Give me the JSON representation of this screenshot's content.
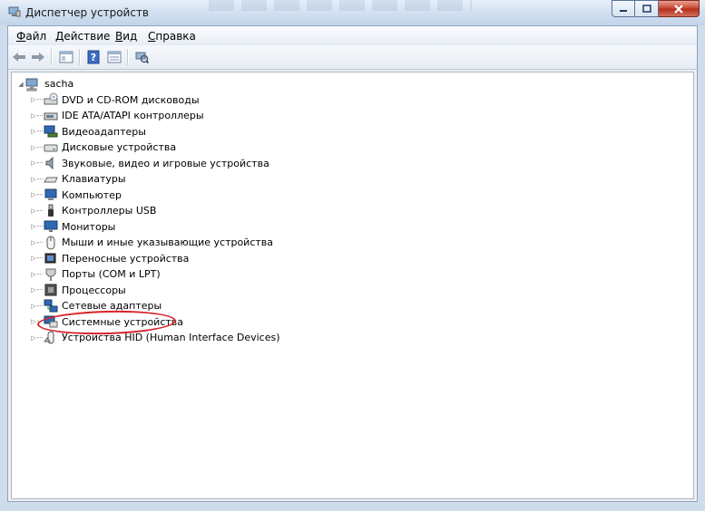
{
  "window": {
    "title": "Диспетчер устройств"
  },
  "menu": [
    {
      "first": "Ф",
      "rest": "айл"
    },
    {
      "first": "Д",
      "rest": "ействие"
    },
    {
      "first": "В",
      "rest": "ид"
    },
    {
      "first": "С",
      "rest": "правка"
    }
  ],
  "toolbar": {
    "icons": [
      "back-arrow-icon",
      "forward-arrow-icon",
      "properties-icon",
      "help-icon",
      "view-icon",
      "scan-hardware-icon"
    ]
  },
  "tree": {
    "root": "sacha",
    "items": [
      {
        "label": "DVD и CD-ROM дисководы",
        "icon": "dvd-drive-icon"
      },
      {
        "label": "IDE ATA/ATAPI контроллеры",
        "icon": "ide-controller-icon"
      },
      {
        "label": "Видеоадаптеры",
        "icon": "display-adapter-icon"
      },
      {
        "label": "Дисковые устройства",
        "icon": "disk-drive-icon"
      },
      {
        "label": "Звуковые, видео и игровые устройства",
        "icon": "speaker-icon"
      },
      {
        "label": "Клавиатуры",
        "icon": "keyboard-icon"
      },
      {
        "label": "Компьютер",
        "icon": "computer-icon"
      },
      {
        "label": "Контроллеры USB",
        "icon": "usb-icon"
      },
      {
        "label": "Мониторы",
        "icon": "monitor-icon"
      },
      {
        "label": "Мыши и иные указывающие устройства",
        "icon": "mouse-icon"
      },
      {
        "label": "Переносные устройства",
        "icon": "portable-device-icon"
      },
      {
        "label": "Порты (COM и LPT)",
        "icon": "port-icon"
      },
      {
        "label": "Процессоры",
        "icon": "processor-icon"
      },
      {
        "label": "Сетевые адаптеры",
        "icon": "network-adapter-icon"
      },
      {
        "label": "Системные устройства",
        "icon": "system-device-icon"
      },
      {
        "label": "Устройства HID (Human Interface Devices)",
        "icon": "hid-icon"
      }
    ],
    "highlighted_item": "Порты (COM и LPT)"
  },
  "colors": {
    "highlight": "#d9232b",
    "close_button": "#c5432f"
  }
}
